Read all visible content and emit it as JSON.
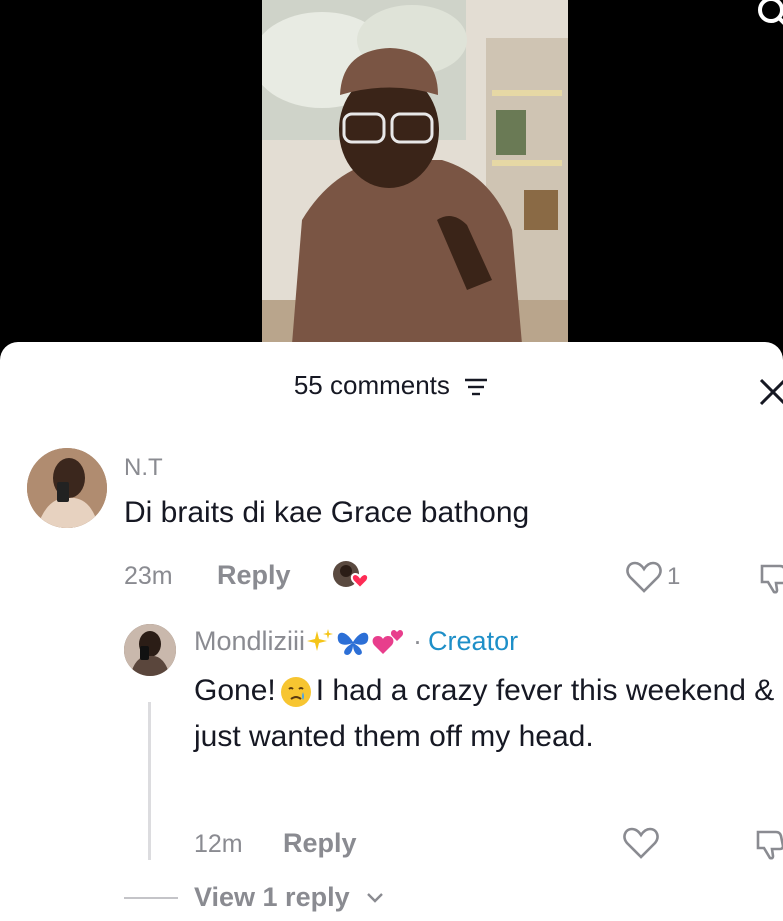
{
  "comments_header": {
    "count_label": "55 comments"
  },
  "comments": [
    {
      "author": "N.T",
      "text": "Di braits di kae Grace bathong",
      "time": "23m",
      "reply_label": "Reply",
      "likes": "1"
    }
  ],
  "reply": {
    "author": "Mondliziii",
    "author_emojis": [
      "sparkles",
      "butterfly",
      "two-hearts"
    ],
    "separator": "·",
    "badge": "Creator",
    "text_before_emoji": "Gone!",
    "emoji": "crying-face",
    "text_after_emoji": "I had a crazy fever this weekend & just wanted them off my head.",
    "time": "12m",
    "reply_label": "Reply"
  },
  "view_replies": {
    "label": "View 1 reply"
  },
  "colors": {
    "creator": "#1e8fc8",
    "muted": "#8a8b91",
    "text": "#161823",
    "like_heart": "#fe2c55"
  }
}
